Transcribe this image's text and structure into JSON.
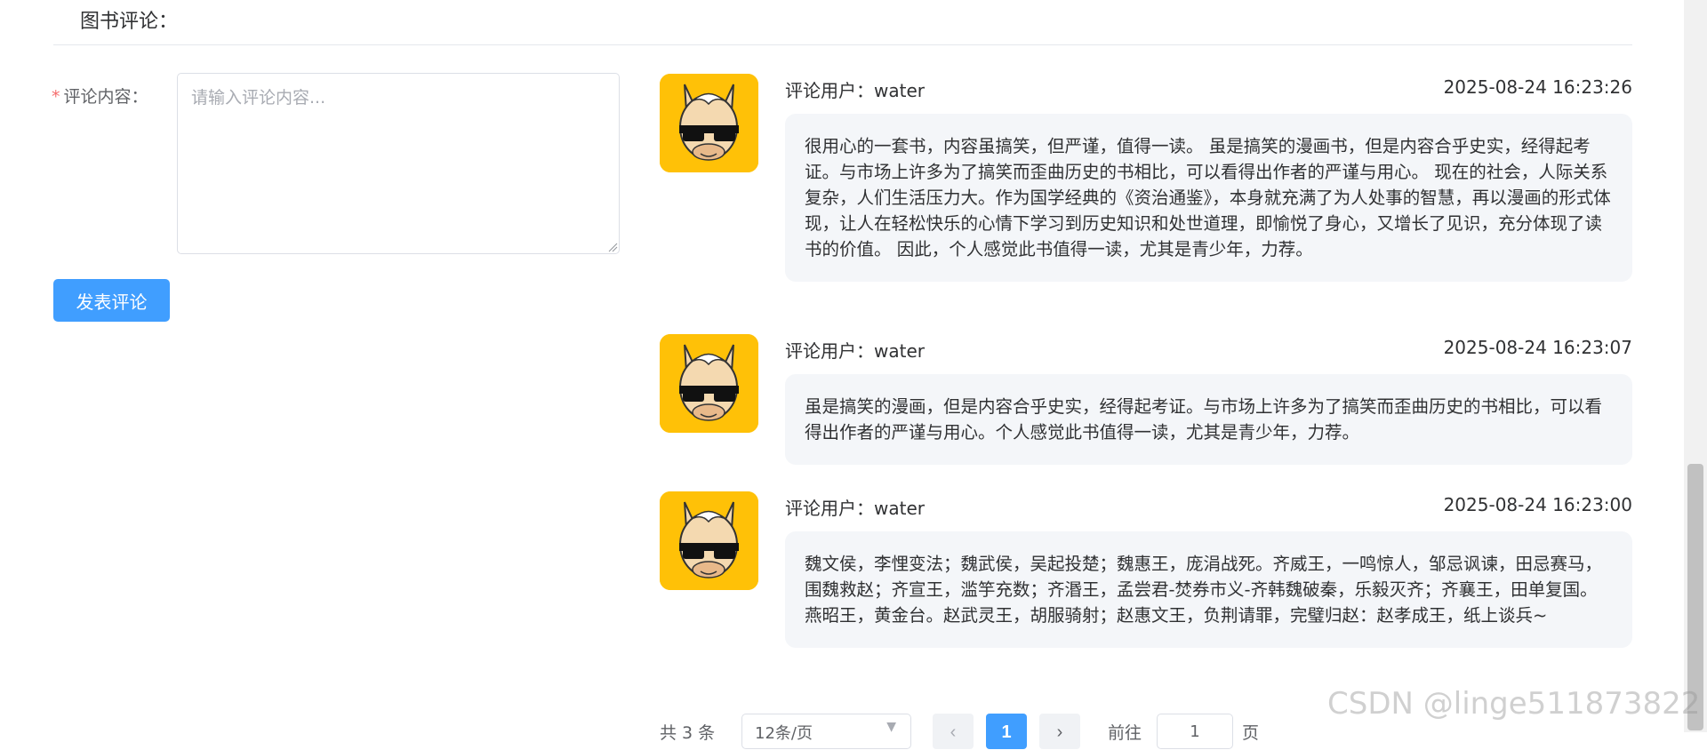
{
  "section": {
    "title": "图书评论："
  },
  "form": {
    "required_mark": "*",
    "label": "评论内容：",
    "placeholder": "请输入评论内容...",
    "value": "",
    "submit_label": "发表评论"
  },
  "comments": [
    {
      "user": "评论用户：water",
      "time": "2025-08-24 16:23:26",
      "text": "很用心的一套书，内容虽搞笑，但严谨，值得一读。 虽是搞笑的漫画书，但是内容合乎史实，经得起考证。与市场上许多为了搞笑而歪曲历史的书相比，可以看得出作者的严谨与用心。 现在的社会，人际关系复杂，人们生活压力大。作为国学经典的《资治通鉴》，本身就充满了为人处事的智慧，再以漫画的形式体现，让人在轻松快乐的心情下学习到历史知识和处世道理，即愉悦了身心，又增长了见识，充分体现了读书的价值。 因此，个人感觉此书值得一读，尤其是青少年，力荐。"
    },
    {
      "user": "评论用户：water",
      "time": "2025-08-24 16:23:07",
      "text": "虽是搞笑的漫画，但是内容合乎史实，经得起考证。与市场上许多为了搞笑而歪曲历史的书相比，可以看得出作者的严谨与用心。个人感觉此书值得一读，尤其是青少年，力荐。"
    },
    {
      "user": "评论用户：water",
      "time": "2025-08-24 16:23:00",
      "text": "魏文侯，李悝变法；魏武侯，吴起投楚；魏惠王，庞涓战死。齐威王，一鸣惊人，邹忌讽谏，田忌赛马，围魏救赵；齐宣王，滥竽充数；齐湣王，孟尝君-焚券市义-齐韩魏破秦，乐毅灭齐；齐襄王，田单复国。燕昭王，黄金台。赵武灵王，胡服骑射；赵惠文王，负荆请罪，完璧归赵：赵孝成王，纸上谈兵~"
    }
  ],
  "pagination": {
    "total": "共 3 条",
    "page_size": "12条/页",
    "prev": "‹",
    "current": "1",
    "next": "›",
    "goto": "前往",
    "goto_value": "1",
    "unit": "页"
  },
  "watermark": "CSDN @linge511873822",
  "colors": {
    "primary": "#409eff",
    "avatar_bg": "#ffc107",
    "bubble_bg": "#f4f6f9"
  }
}
